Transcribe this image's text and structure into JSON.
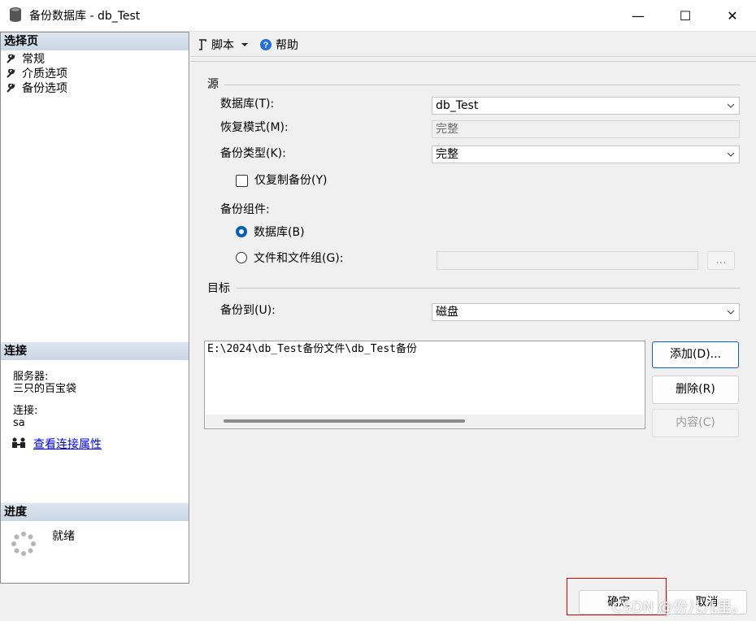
{
  "window": {
    "title": "备份数据库 - db_Test",
    "controls": {
      "minimize": "—",
      "maximize": "☐",
      "close": "✕"
    }
  },
  "left": {
    "select_page_header": "选择页",
    "pages": [
      {
        "label": "常规"
      },
      {
        "label": "介质选项"
      },
      {
        "label": "备份选项"
      }
    ],
    "connection_header": "连接",
    "server_label": "服务器:",
    "server_value": "三只的百宝袋",
    "connection_label": "连接:",
    "connection_value": "sa",
    "view_connection_link": "查看连接属性",
    "progress_header": "进度",
    "progress_status": "就绪"
  },
  "toolbar": {
    "script_label": "脚本",
    "help_label": "帮助"
  },
  "source": {
    "section_title": "源",
    "database_label": "数据库(T):",
    "database_value": "db_Test",
    "recovery_label": "恢复模式(M):",
    "recovery_value": "完整",
    "backup_type_label": "备份类型(K):",
    "backup_type_value": "完整",
    "copy_only_label": "仅复制备份(Y)",
    "copy_only_checked": false,
    "component_label": "备份组件:",
    "component_database": "数据库(B)",
    "component_files": "文件和文件组(G):",
    "component_selected": "database",
    "files_browse": "..."
  },
  "destination": {
    "section_title": "目标",
    "backup_to_label": "备份到(U):",
    "backup_to_value": "磁盘",
    "paths": [
      "E:\\2024\\db_Test备份文件\\db_Test备份"
    ],
    "add_button": "添加(D)...",
    "remove_button": "删除(R)",
    "contents_button": "内容(C)"
  },
  "footer": {
    "ok_button": "确定",
    "cancel_button": "取消",
    "watermark": "CSDN @份儿儿里。"
  },
  "colors": {
    "header_bg": "#c9d6e4",
    "accent": "#005fb8",
    "link": "#0000ee",
    "highlight_box": "#e00000"
  }
}
